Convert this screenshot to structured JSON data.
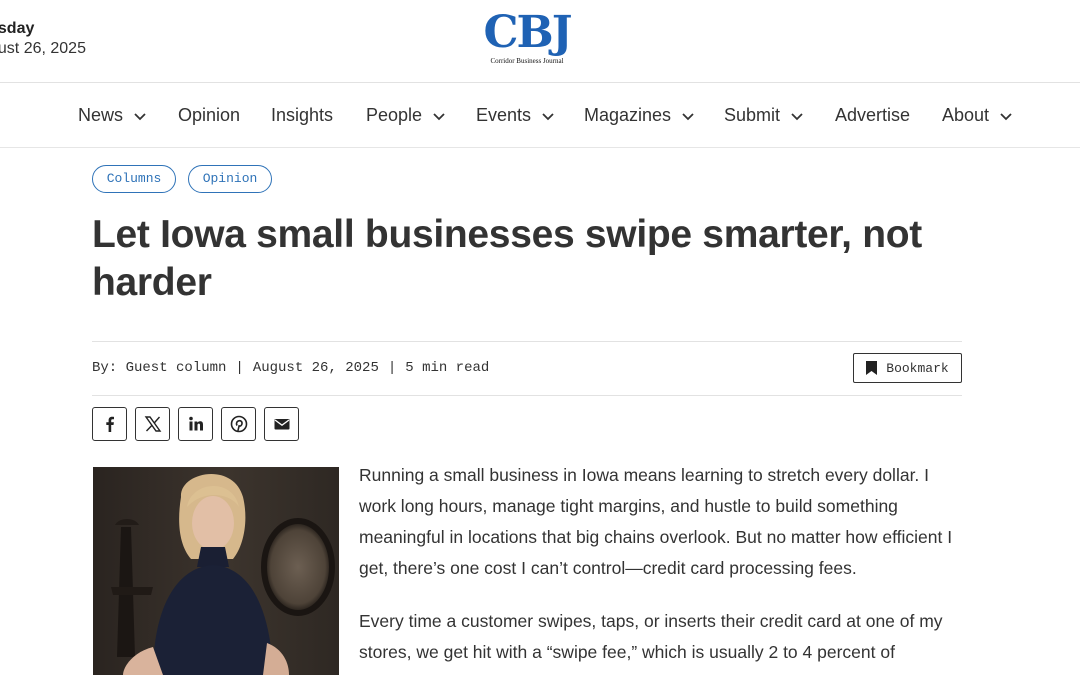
{
  "header": {
    "weekday": "esday",
    "date": "gust 26, 2025",
    "logo_text": "CBJ",
    "logo_subtitle": "Corridor Business Journal",
    "brand_color": "#1f62b4"
  },
  "nav": {
    "items": [
      {
        "label": "News",
        "has_dropdown": true
      },
      {
        "label": "Opinion",
        "has_dropdown": false
      },
      {
        "label": "Insights",
        "has_dropdown": false
      },
      {
        "label": "People",
        "has_dropdown": true
      },
      {
        "label": "Events",
        "has_dropdown": true
      },
      {
        "label": "Magazines",
        "has_dropdown": true
      },
      {
        "label": "Submit",
        "has_dropdown": true
      },
      {
        "label": "Advertise",
        "has_dropdown": false
      },
      {
        "label": "About",
        "has_dropdown": true
      }
    ]
  },
  "article": {
    "tags": [
      "Columns",
      "Opinion"
    ],
    "tag_color": "#2f73b8",
    "title": "Let Iowa small businesses swipe smarter, not harder",
    "byline": "By: Guest column",
    "date": "August 26, 2025",
    "read_time": "5 min read",
    "bookmark_label": "Bookmark",
    "share_icons": [
      "facebook-icon",
      "x-icon",
      "linkedin-icon",
      "pinterest-icon",
      "email-icon"
    ],
    "paragraphs": [
      "Running a small business in Iowa means learning to stretch every dollar. I work long hours, manage tight margins, and hustle to build something meaningful in locations that big chains overlook. But no matter how efficient I get, there’s one cost I can’t control—credit card processing fees.",
      "Every time a customer swipes, taps, or inserts their credit card at one of my stores, we get hit with a “swipe fee,” which is usually 2 to 4 percent of"
    ]
  }
}
